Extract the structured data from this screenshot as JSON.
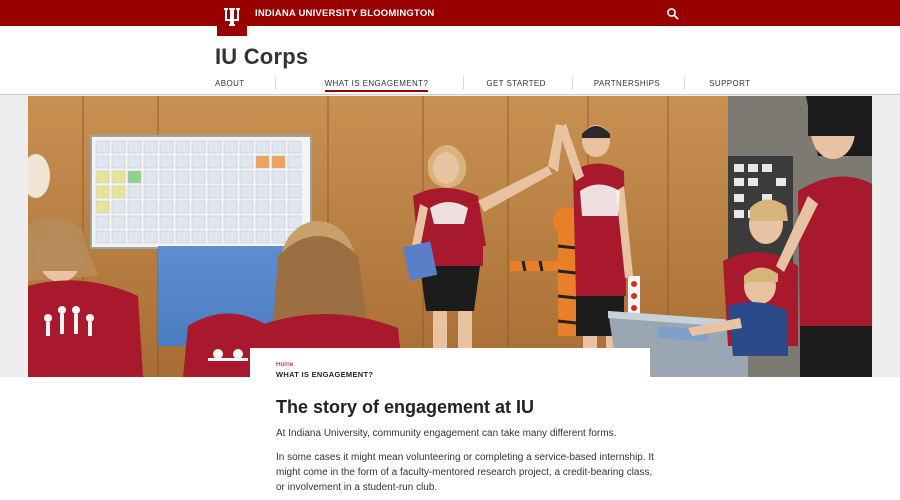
{
  "brand": {
    "university_name": "INDIANA UNIVERSITY BLOOMINGTON",
    "bar_color": "#990000",
    "logo_icon": "iu-trident-icon",
    "search_icon": "search-icon"
  },
  "site": {
    "title": "IU Corps"
  },
  "nav": {
    "items": [
      {
        "label": "ABOUT",
        "active": false
      },
      {
        "label": "WHAT IS ENGAGEMENT?",
        "active": true
      },
      {
        "label": "GET STARTED",
        "active": false
      },
      {
        "label": "PARTNERSHIPS",
        "active": false
      },
      {
        "label": "SUPPORT",
        "active": false
      }
    ]
  },
  "breadcrumb": {
    "home": "Home",
    "current": "WHAT IS ENGAGEMENT?"
  },
  "content": {
    "heading": "The story of engagement at IU",
    "paragraphs": [
      "At Indiana University, community engagement can take many different forms.",
      "In some cases it might mean volunteering or completing a service-based internship. It might come in the form of a faculty-mentored research project, a credit-bearing class, or involvement in a student-run club."
    ]
  }
}
